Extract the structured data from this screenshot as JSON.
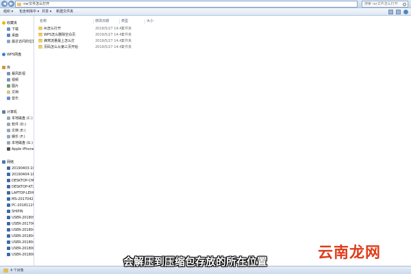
{
  "address_bar": {
    "path": "rar文件怎么打开",
    "search_placeholder": "搜索 rar文件怎么打开",
    "back_glyph": "◀",
    "forward_glyph": "▶"
  },
  "command_bar": {
    "organize": "组织 ▾",
    "include_in_library": "包含到库中 ▾",
    "share": "共享 ▾",
    "new_folder": "新建文件夹"
  },
  "nav_pane": {
    "favorites": {
      "header": "收藏夹",
      "items": [
        "下载",
        "桌面",
        "最近访问的位置"
      ]
    },
    "wps_cloud": "WPS网盘",
    "libraries": {
      "header": "库",
      "items": [
        "暴风影视",
        "视频",
        "图片",
        "文档",
        "音乐"
      ]
    },
    "computer": {
      "header": "计算机",
      "items": [
        "本地磁盘 (C:)",
        "软件 (D:)",
        "文档 (E:)",
        "娱乐 (F:)",
        "本地磁盘 (G:)",
        "Apple iPhone"
      ]
    },
    "network": {
      "header": "网络",
      "items": [
        "20190403-1043",
        "20190404-1848",
        "DESKTOP-CMSC",
        "DESKTOP-KT2C",
        "LAPTOP-LEIH08",
        "MS-20170425DI",
        "PC-2018112914",
        "SHIPIN",
        "USER-20180928",
        "USER-20170621",
        "USER-20180419",
        "USER-20180419",
        "USER-20180420",
        "USER-20180806",
        "USER-20180816"
      ]
    }
  },
  "columns": {
    "name": "名称",
    "date": "修改日期",
    "type": "类型",
    "size": "大小"
  },
  "files": [
    {
      "name": "AI怎么打开",
      "date": "2019/5/27 14:42",
      "type": "文件夹"
    },
    {
      "name": "WPS怎么删除空白页",
      "date": "2019/5/27 14:42",
      "type": "文件夹"
    },
    {
      "name": "蜂窝流量最上怎么打",
      "date": "2019/5/27 14:42",
      "type": "文件夹"
    },
    {
      "name": "页码怎么从第三页开始",
      "date": "2019/5/27 14:42",
      "type": "文件夹"
    }
  ],
  "status_bar": {
    "item_count": "4 个对象"
  },
  "overlay": {
    "caption": "会解压到压缩包存放的所在位置",
    "watermark": "云南龙网"
  },
  "colors": {
    "folder": "#eccb73",
    "caption_text": "#ffffff",
    "watermark": "#e03c1a",
    "chrome_blue": "#c9d9ee"
  }
}
